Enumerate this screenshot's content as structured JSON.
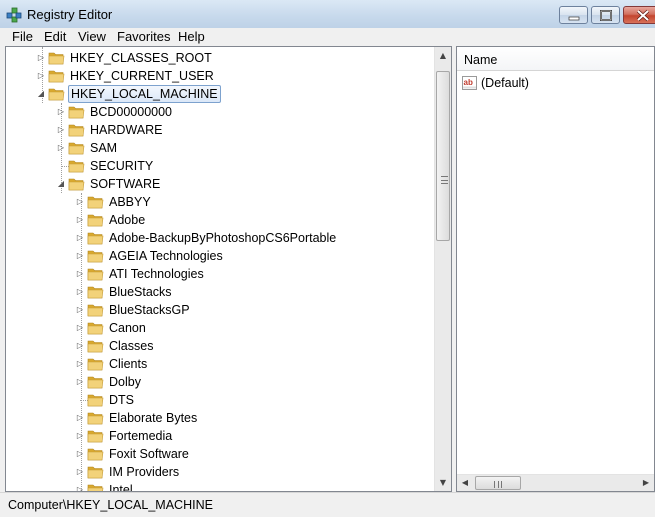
{
  "window": {
    "title": "Registry Editor",
    "icon": "registry-editor-icon"
  },
  "menu": [
    "File",
    "Edit",
    "View",
    "Favorites",
    "Help"
  ],
  "tree": {
    "roots": [
      {
        "label": "HKEY_CLASSES_ROOT",
        "expanded": false
      },
      {
        "label": "HKEY_CURRENT_USER",
        "expanded": false
      },
      {
        "label": "HKEY_LOCAL_MACHINE",
        "expanded": true,
        "selected": true
      }
    ],
    "hklm_children": [
      {
        "label": "BCD00000000",
        "expander": true
      },
      {
        "label": "HARDWARE",
        "expander": true
      },
      {
        "label": "SAM",
        "expander": true
      },
      {
        "label": "SECURITY",
        "expander": false
      },
      {
        "label": "SOFTWARE",
        "expander": "expanded"
      }
    ],
    "software_children": [
      {
        "label": "ABBYY",
        "expander": true
      },
      {
        "label": "Adobe",
        "expander": true
      },
      {
        "label": "Adobe-BackupByPhotoshopCS6Portable",
        "expander": true
      },
      {
        "label": "AGEIA Technologies",
        "expander": true
      },
      {
        "label": "ATI Technologies",
        "expander": true
      },
      {
        "label": "BlueStacks",
        "expander": true
      },
      {
        "label": "BlueStacksGP",
        "expander": true
      },
      {
        "label": "Canon",
        "expander": true
      },
      {
        "label": "Classes",
        "expander": true
      },
      {
        "label": "Clients",
        "expander": true
      },
      {
        "label": "Dolby",
        "expander": true
      },
      {
        "label": "DTS",
        "expander": false
      },
      {
        "label": "Elaborate Bytes",
        "expander": true
      },
      {
        "label": "Fortemedia",
        "expander": true
      },
      {
        "label": "Foxit Software",
        "expander": true
      },
      {
        "label": "IM Providers",
        "expander": true
      },
      {
        "label": "Intel",
        "expander": true
      }
    ]
  },
  "values": {
    "column_header": "Name",
    "rows": [
      {
        "name": "(Default)",
        "icon": "string-value-icon"
      }
    ]
  },
  "status": {
    "path": "Computer\\HKEY_LOCAL_MACHINE"
  },
  "colors": {
    "folder": "#e8c65a",
    "selection_border": "#7da2ce",
    "titlebar": "#c7d9ec"
  }
}
